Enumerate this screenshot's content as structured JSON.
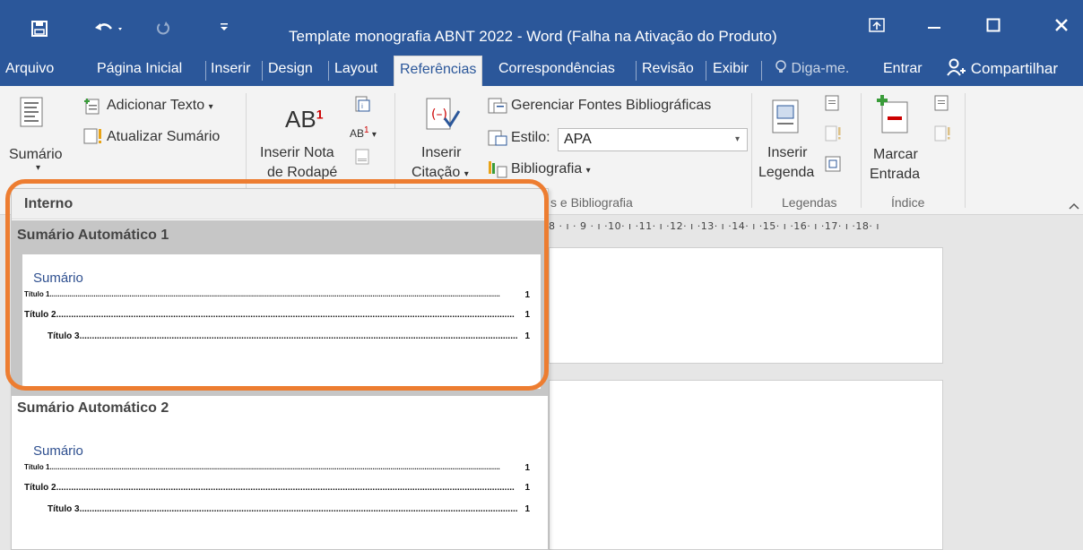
{
  "window": {
    "title": "Template monografia ABNT 2022 - Word (Falha na Ativação do Produto)"
  },
  "tabs": [
    {
      "label": "Arquivo"
    },
    {
      "label": "Página Inicial"
    },
    {
      "label": "Inserir"
    },
    {
      "label": "Design"
    },
    {
      "label": "Layout"
    },
    {
      "label": "Referências"
    },
    {
      "label": "Correspondências"
    },
    {
      "label": "Revisão"
    },
    {
      "label": "Exibir"
    }
  ],
  "tell_me": "Diga-me.",
  "sign_in": "Entrar",
  "share": "Compartilhar",
  "ribbon": {
    "toc": {
      "label": "Sumário",
      "add_text": "Adicionar Texto",
      "update": "Atualizar Sumário"
    },
    "footnotes": {
      "insert_line1": "Inserir Nota",
      "insert_line2": "de Rodapé"
    },
    "citations": {
      "insert_line1": "Inserir",
      "insert_line2": "Citação",
      "manage": "Gerenciar Fontes Bibliográficas",
      "style_label": "Estilo:",
      "style_value": "APA",
      "bibliography": "Bibliografia",
      "group_label": "s e Bibliografia"
    },
    "captions": {
      "insert_line1": "Inserir",
      "insert_line2": "Legenda",
      "group_label": "Legendas"
    },
    "index": {
      "mark_line1": "Marcar",
      "mark_line2": "Entrada",
      "group_label": "Índice"
    }
  },
  "ruler_text": "8 · ı · 9 · ı ·10· ı ·11· ı ·12· ı ·13· ı ·14· ı ·15· ı ·16· ı ·17· ı ·18· ı",
  "toc_menu": {
    "section": "Interno",
    "items": [
      {
        "title": "Sumário Automático 1",
        "heading": "Sumário",
        "entries": [
          {
            "text": "Título 1",
            "page": "1"
          },
          {
            "text": "Título 2",
            "page": "1"
          },
          {
            "text": "Título 3",
            "page": "1"
          }
        ]
      },
      {
        "title": "Sumário Automático 2",
        "heading": "Sumário",
        "entries": [
          {
            "text": "Título 1",
            "page": "1"
          },
          {
            "text": "Título 2",
            "page": "1"
          },
          {
            "text": "Título 3",
            "page": "1"
          }
        ]
      }
    ]
  },
  "colors": {
    "title_bar": "#2b579a",
    "highlight": "#ed7d31",
    "heading_blue": "#2e4f8f"
  }
}
